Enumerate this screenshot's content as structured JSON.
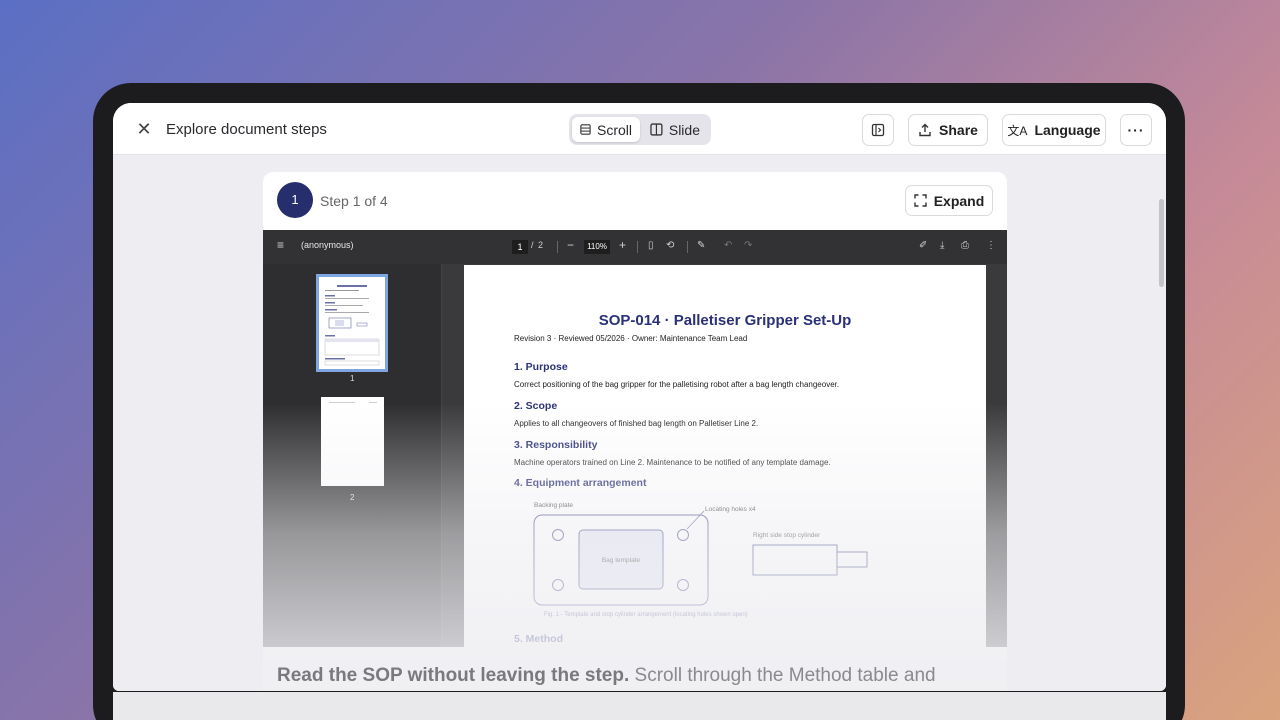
{
  "topbar": {
    "title": "Explore document steps",
    "view_modes": [
      {
        "label": "Scroll",
        "active": true
      },
      {
        "label": "Slide",
        "active": false
      }
    ],
    "share_label": "Share",
    "language_label": "Language"
  },
  "step": {
    "number": "1",
    "label": "Step 1 of 4",
    "expand_label": "Expand"
  },
  "pdf": {
    "filename": "(anonymous)",
    "current_page": "1",
    "page_sep": "/",
    "total_pages": "2",
    "zoom": "110%",
    "thumbnails": [
      "1",
      "2"
    ]
  },
  "document": {
    "title": "SOP-014 · Palletiser Gripper Set-Up",
    "meta": "Revision 3 · Reviewed 05/2026 · Owner: Maintenance Team Lead",
    "sections": [
      {
        "heading": "1. Purpose",
        "body": "Correct positioning of the bag gripper for the palletising robot after a bag length changeover."
      },
      {
        "heading": "2. Scope",
        "body": "Applies to all changeovers of finished bag length on Palletiser Line 2."
      },
      {
        "heading": "3. Responsibility",
        "body": "Machine operators trained on Line 2. Maintenance to be notified of any template damage."
      },
      {
        "heading": "4. Equipment arrangement",
        "body": ""
      }
    ],
    "figure": {
      "backing_plate": "Backing plate",
      "locating_holes": "Locating holes x4",
      "bag_template": "Bag template",
      "stop_cylinder": "Right side stop cylinder",
      "caption": "Fig. 1 - Template and stop cylinder arrangement (locating holes shown open)"
    },
    "next_heading": "5. Method"
  },
  "caption": {
    "bold": "Read the SOP without leaving the step.",
    "rest": " Scroll through the Method table and"
  },
  "colors": {
    "accent": "#262e6e",
    "heading": "#2b3177"
  }
}
